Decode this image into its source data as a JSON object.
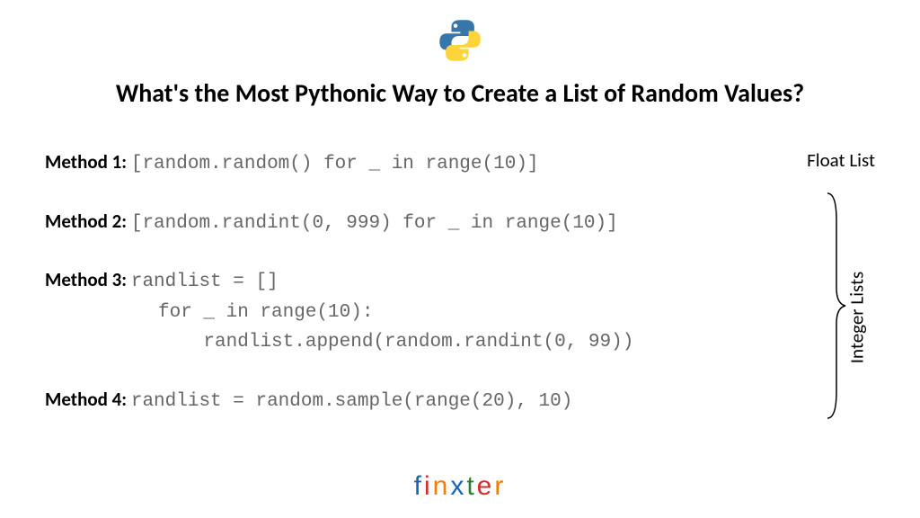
{
  "title": "What's the Most Pythonic Way to Create a List of Random Values?",
  "methods": [
    {
      "label": "Method 1",
      "code": "[random.random() for _ in range(10)]"
    },
    {
      "label": "Method 2",
      "code": "[random.randint(0, 999) for _ in range(10)]"
    },
    {
      "label": "Method 3",
      "code": "randlist = []\n          for _ in range(10):\n              randlist.append(random.randint(0, 99))"
    },
    {
      "label": "Method 4",
      "code": "randlist = random.sample(range(20), 10)"
    }
  ],
  "annotations": {
    "float": "Float List",
    "integer": "Integer Lists"
  },
  "brand": {
    "letters": [
      "f",
      "i",
      "n",
      "x",
      "t",
      "e",
      "r"
    ]
  }
}
